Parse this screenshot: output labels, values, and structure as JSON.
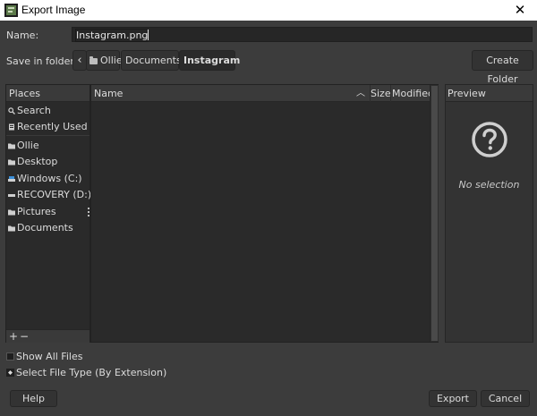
{
  "window": {
    "title": "Export Image",
    "close_glyph": "✕"
  },
  "name_row": {
    "label": "Name:",
    "value": "Instagram.png"
  },
  "save_row": {
    "label": "Save in folder:",
    "back_glyph": "‹",
    "path": [
      {
        "label": "Ollie",
        "icon": "folder-icon"
      },
      {
        "label": "Documents"
      },
      {
        "label": "Instagram"
      }
    ],
    "create_folder_label": "Create Folder"
  },
  "places": {
    "header": "Places",
    "items": [
      {
        "label": "Search",
        "icon": "search-icon"
      },
      {
        "label": "Recently Used",
        "icon": "recent-icon"
      },
      {
        "label": "Ollie",
        "icon": "folder-icon"
      },
      {
        "label": "Desktop",
        "icon": "folder-icon"
      },
      {
        "label": "Windows (C:)",
        "icon": "drive-icon"
      },
      {
        "label": "RECOVERY (D:)",
        "icon": "drive-icon"
      },
      {
        "label": "Pictures",
        "icon": "folder-icon"
      },
      {
        "label": "Documents",
        "icon": "folder-icon"
      }
    ],
    "add_glyph": "+",
    "remove_glyph": "−"
  },
  "files": {
    "columns": {
      "name": "Name",
      "size": "Size",
      "modified": "Modified"
    },
    "sort_glyph": "︿",
    "rows": []
  },
  "preview": {
    "header": "Preview",
    "empty_text": "No selection",
    "icon": "question-icon"
  },
  "options": {
    "show_all_files": "Show All Files",
    "select_file_type": "Select File Type (By Extension)"
  },
  "buttons": {
    "help": "Help",
    "export": "Export",
    "cancel": "Cancel"
  },
  "colors": {
    "background": "#3c3c3c",
    "panel": "#2a2a2a",
    "text": "#dcdcdc"
  }
}
